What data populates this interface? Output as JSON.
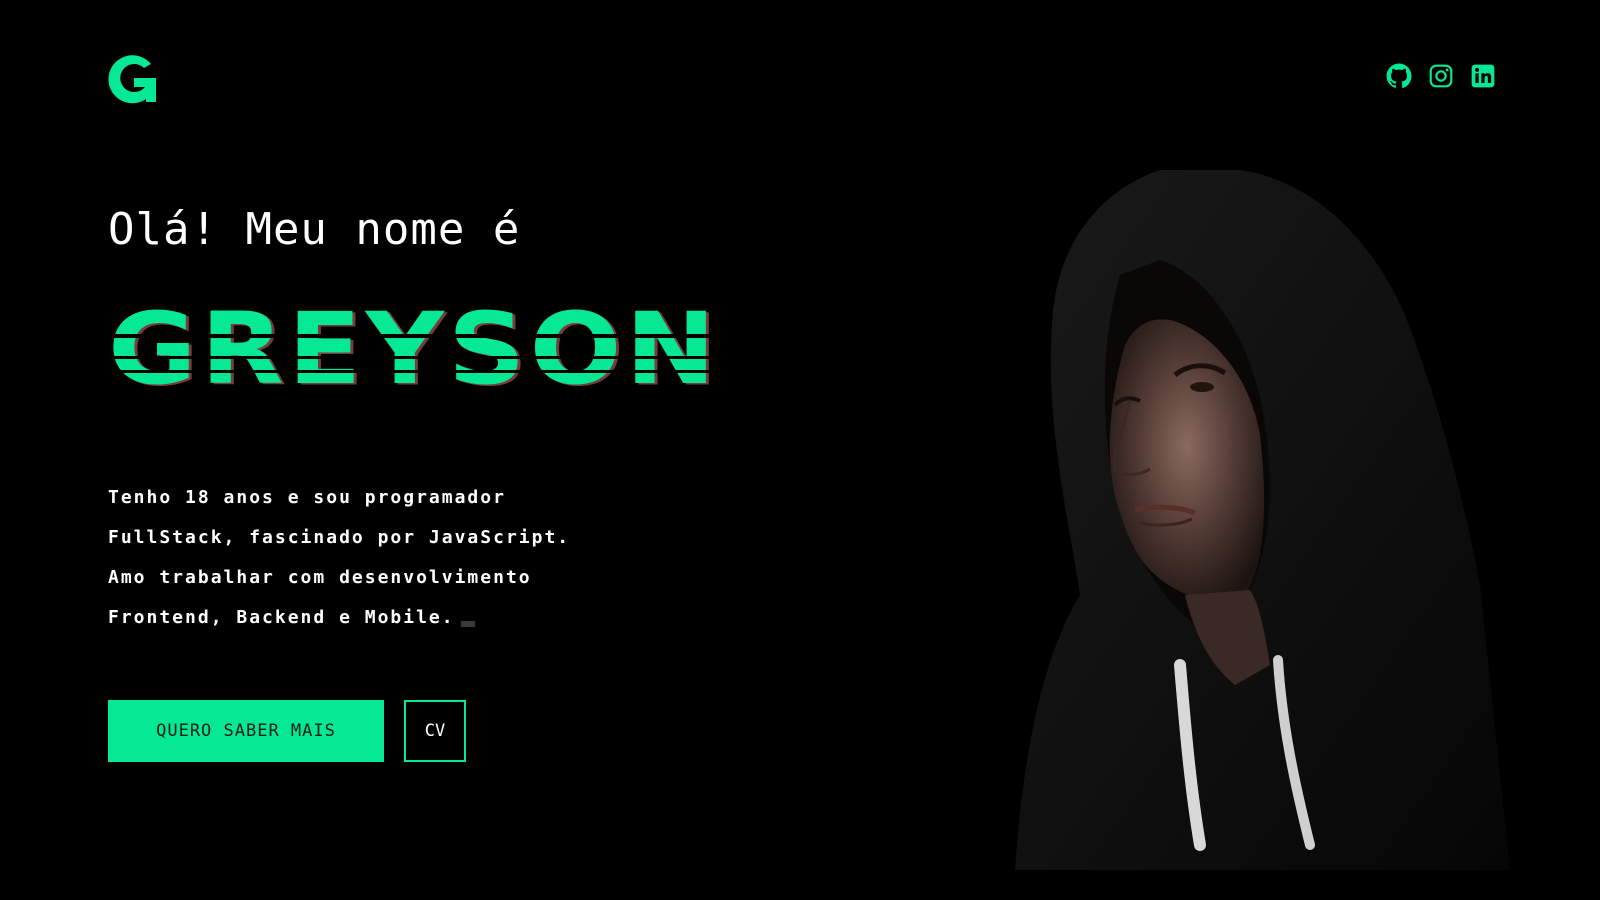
{
  "header": {
    "logo_icon": "g-logo-icon",
    "social_icons": [
      "github-icon",
      "instagram-icon",
      "linkedin-icon"
    ]
  },
  "hero": {
    "greeting": "Olá! Meu nome é",
    "name": "GREYSON",
    "bio_lines": [
      "Tenho 18 anos e sou programador",
      "FullStack, fascinado por JavaScript.",
      "Amo trabalhar com desenvolvimento",
      "Frontend, Backend e Mobile."
    ],
    "primary_button_label": "QUERO SABER MAIS",
    "cv_button_label": "CV",
    "portrait_icon": "portrait-photo"
  },
  "colors": {
    "background": "#000000",
    "accent": "#05e894",
    "text": "#ffffff"
  }
}
